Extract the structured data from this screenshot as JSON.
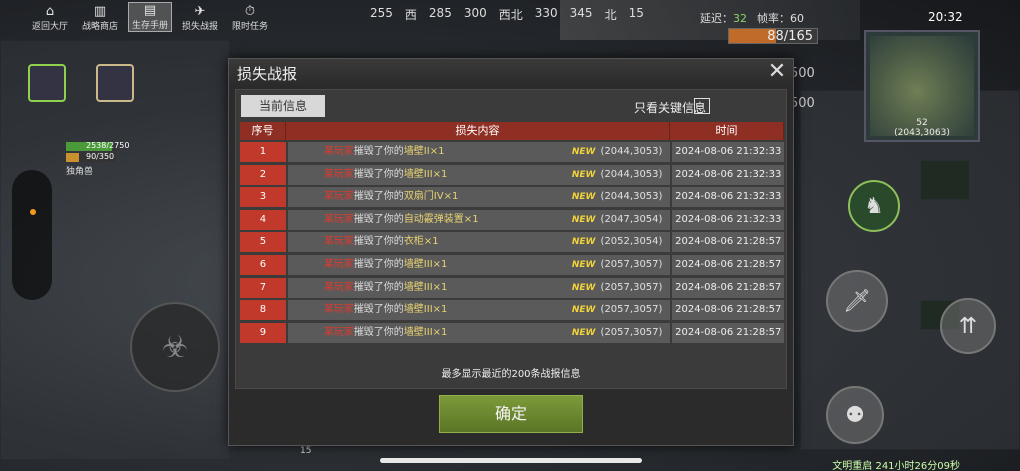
{
  "top_menu": [
    {
      "label": "返回大厅",
      "icon": "home-icon"
    },
    {
      "label": "战略商店",
      "icon": "shop-icon"
    },
    {
      "label": "生存手册",
      "icon": "book-icon"
    },
    {
      "label": "损失战报",
      "icon": "report-icon"
    },
    {
      "label": "限时任务",
      "icon": "timer-icon"
    }
  ],
  "compass": [
    "255",
    "西",
    "285",
    "300",
    "西北",
    "330",
    "345",
    "北",
    "15"
  ],
  "status": {
    "latency_label": "延迟：",
    "latency_value": "32",
    "fps_label": "帧率：",
    "fps_value": "60"
  },
  "health": {
    "text": "88/165",
    "fraction": 0.533
  },
  "clock": "20:32",
  "minimap": {
    "zone": "52",
    "coords": "(2043,3063)"
  },
  "player": {
    "hp_text": "2538/2750",
    "hp_fraction": 0.92,
    "hunger_text": "90/350",
    "hunger_fraction": 0.26,
    "name": "独角兽"
  },
  "background_text": {
    "left_num": "15",
    "right_500a": "500",
    "right_500b": "500",
    "bottom_info": "文明重启 241小时26分09秒"
  },
  "dialog": {
    "title": "损失战报",
    "tab_current": "当前信息",
    "filter_label": "只看关键信息",
    "headers": {
      "index": "序号",
      "content": "损失内容",
      "time": "时间"
    },
    "rows": [
      {
        "index": "1",
        "who": "某玩家",
        "action": "摧毁了你的",
        "item": "墙壁II×1",
        "badge": "NEW",
        "coord": "(2044,3053)",
        "time": "2024-08-06 21:32:33"
      },
      {
        "index": "2",
        "who": "某玩家",
        "action": "摧毁了你的",
        "item": "墙壁III×1",
        "badge": "NEW",
        "coord": "(2044,3053)",
        "time": "2024-08-06 21:32:33"
      },
      {
        "index": "3",
        "who": "某玩家",
        "action": "摧毁了你的",
        "item": "双扇门IV×1",
        "badge": "NEW",
        "coord": "(2044,3053)",
        "time": "2024-08-06 21:32:33"
      },
      {
        "index": "4",
        "who": "某玩家",
        "action": "摧毁了你的",
        "item": "自动霰弹装置×1",
        "badge": "NEW",
        "coord": "(2047,3054)",
        "time": "2024-08-06 21:32:33"
      },
      {
        "index": "5",
        "who": "某玩家",
        "action": "摧毁了你的",
        "item": "衣柜×1",
        "badge": "NEW",
        "coord": "(2052,3054)",
        "time": "2024-08-06 21:28:57"
      },
      {
        "index": "6",
        "who": "某玩家",
        "action": "摧毁了你的",
        "item": "墙壁III×1",
        "badge": "NEW",
        "coord": "(2057,3057)",
        "time": "2024-08-06 21:28:57"
      },
      {
        "index": "7",
        "who": "某玩家",
        "action": "摧毁了你的",
        "item": "墙壁III×1",
        "badge": "NEW",
        "coord": "(2057,3057)",
        "time": "2024-08-06 21:28:57"
      },
      {
        "index": "8",
        "who": "某玩家",
        "action": "摧毁了你的",
        "item": "墙壁III×1",
        "badge": "NEW",
        "coord": "(2057,3057)",
        "time": "2024-08-06 21:28:57"
      },
      {
        "index": "9",
        "who": "某玩家",
        "action": "摧毁了你的",
        "item": "墙壁III×1",
        "badge": "NEW",
        "coord": "(2057,3057)",
        "time": "2024-08-06 21:28:57"
      }
    ],
    "footnote": "最多显示最近的200条战报信息",
    "confirm_label": "确定"
  },
  "colors": {
    "accent_red": "#c0392b",
    "header_red": "#8f2e23",
    "confirm_green": "#6f8b31",
    "item_yellow": "#e8d372",
    "new_badge": "#f0d23a"
  }
}
